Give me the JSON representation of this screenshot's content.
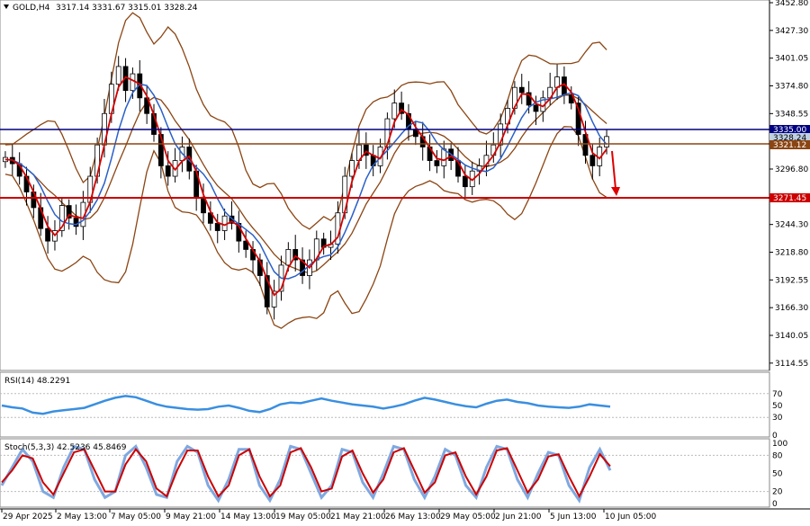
{
  "header": {
    "symbol": "GOLD,H4",
    "ohlc": "3317.14 3331.67 3315.01 3328.24"
  },
  "rsi_label": "RSI(14) 48.2291",
  "stoch_label": "Stoch(5,3,3) 42.5236 45.8469",
  "price_levels": {
    "blue_line": "3335.00",
    "current": "3328.24",
    "brown_line": "3321.12",
    "red_line": "3271.45"
  },
  "colors": {
    "bull_candle": "#000000",
    "bear_candle": "#000000",
    "ma_fast": "#d40000",
    "ma_slow": "#2a60c8",
    "bollinger": "#8b4513",
    "rsi": "#3a8fe0",
    "stoch_main": "#7fa8e0",
    "stoch_signal": "#cc0000",
    "blue_level": "#000080",
    "brown_level": "#8b4513",
    "red_level": "#cc0000",
    "arrow": "#dd0000"
  },
  "chart_data": {
    "type": "candlestick",
    "y_ticks": [
      "3452.80",
      "3427.30",
      "3401.05",
      "3374.80",
      "3348.55",
      "3322.30",
      "3296.80",
      "3270.55",
      "3244.30",
      "3218.80",
      "3192.55",
      "3166.30",
      "3140.05",
      "3114.55"
    ],
    "ylim": [
      3106,
      3456
    ],
    "x_labels": [
      "29 Apr 2025",
      "2 May 13:00",
      "7 May 05:00",
      "9 May 21:00",
      "14 May 13:00",
      "19 May 05:00",
      "21 May 21:00",
      "26 May 13:00",
      "29 May 05:00",
      "2 Jun 21:00",
      "5 Jun 13:00",
      "10 Jun 05:00"
    ],
    "close_path": [
      3308,
      3302,
      3290,
      3275,
      3260,
      3240,
      3228,
      3238,
      3262,
      3250,
      3242,
      3265,
      3290,
      3320,
      3350,
      3378,
      3395,
      3372,
      3388,
      3365,
      3350,
      3330,
      3300,
      3290,
      3305,
      3318,
      3295,
      3270,
      3255,
      3245,
      3238,
      3252,
      3245,
      3228,
      3220,
      3210,
      3195,
      3165,
      3180,
      3205,
      3220,
      3210,
      3195,
      3210,
      3230,
      3222,
      3225,
      3255,
      3290,
      3305,
      3320,
      3310,
      3300,
      3318,
      3345,
      3360,
      3350,
      3335,
      3328,
      3318,
      3305,
      3300,
      3316,
      3305,
      3290,
      3280,
      3295,
      3300,
      3310,
      3320,
      3340,
      3355,
      3375,
      3370,
      3358,
      3352,
      3365,
      3375,
      3385,
      3368,
      3360,
      3330,
      3310,
      3300,
      3318,
      3328
    ],
    "rsi": {
      "levels": [
        "70",
        "50",
        "30",
        "0"
      ],
      "ylim": [
        0,
        100
      ],
      "values": [
        50,
        47,
        45,
        38,
        36,
        40,
        42,
        44,
        46,
        52,
        58,
        63,
        66,
        64,
        58,
        52,
        48,
        46,
        44,
        43,
        44,
        48,
        50,
        46,
        41,
        39,
        44,
        52,
        55,
        54,
        58,
        62,
        58,
        55,
        52,
        50,
        48,
        45,
        48,
        52,
        58,
        63,
        60,
        56,
        52,
        49,
        47,
        53,
        58,
        60,
        56,
        54,
        50,
        48,
        47,
        46,
        48,
        52,
        50,
        48
      ]
    },
    "stoch": {
      "levels": [
        "100",
        "80",
        "50",
        "20",
        "0"
      ],
      "ylim": [
        0,
        100
      ],
      "main": [
        30,
        60,
        90,
        70,
        20,
        10,
        60,
        95,
        90,
        40,
        10,
        20,
        80,
        95,
        60,
        15,
        10,
        70,
        95,
        85,
        30,
        5,
        40,
        90,
        90,
        30,
        5,
        40,
        95,
        90,
        50,
        10,
        30,
        90,
        85,
        35,
        10,
        50,
        95,
        90,
        40,
        10,
        45,
        90,
        80,
        30,
        10,
        60,
        95,
        90,
        40,
        10,
        50,
        85,
        80,
        30,
        5,
        60,
        90,
        55
      ],
      "signal": [
        35,
        55,
        80,
        75,
        35,
        15,
        50,
        85,
        90,
        55,
        20,
        20,
        65,
        90,
        70,
        25,
        12,
        55,
        88,
        88,
        45,
        12,
        30,
        80,
        90,
        45,
        12,
        30,
        85,
        92,
        60,
        20,
        25,
        78,
        88,
        50,
        18,
        40,
        85,
        92,
        55,
        18,
        35,
        80,
        85,
        45,
        15,
        45,
        88,
        92,
        55,
        18,
        40,
        78,
        82,
        45,
        12,
        45,
        82,
        62
      ]
    }
  }
}
